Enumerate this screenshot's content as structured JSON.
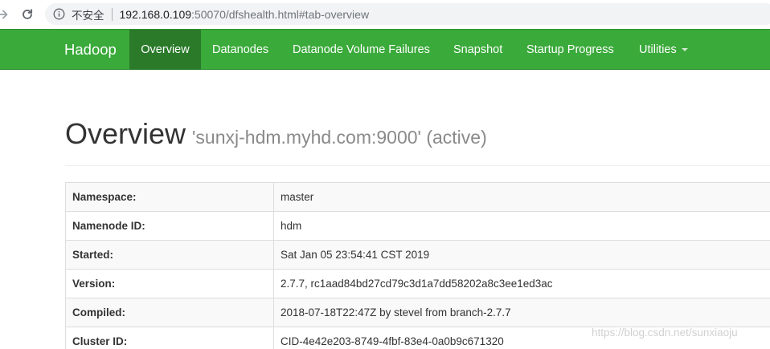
{
  "browser": {
    "insecure_label": "不安全",
    "url_host": "192.168.0.109",
    "url_rest": ":50070/dfshealth.html#tab-overview"
  },
  "navbar": {
    "brand": "Hadoop",
    "items": [
      {
        "label": "Overview",
        "active": true
      },
      {
        "label": "Datanodes"
      },
      {
        "label": "Datanode Volume Failures"
      },
      {
        "label": "Snapshot"
      },
      {
        "label": "Startup Progress"
      },
      {
        "label": "Utilities",
        "dropdown": true
      }
    ]
  },
  "header": {
    "title": "Overview",
    "subtitle": "'sunxj-hdm.myhd.com:9000' (active)"
  },
  "overview_table": {
    "rows": [
      {
        "key": "Namespace:",
        "value": "master"
      },
      {
        "key": "Namenode ID:",
        "value": "hdm"
      },
      {
        "key": "Started:",
        "value": "Sat Jan 05 23:54:41 CST 2019"
      },
      {
        "key": "Version:",
        "value": "2.7.7, rc1aad84bd27cd79c3d1a7dd58202a8c3ee1ed3ac"
      },
      {
        "key": "Compiled:",
        "value": "2018-07-18T22:47Z by stevel from branch-2.7.7"
      },
      {
        "key": "Cluster ID:",
        "value": "CID-4e42e203-8749-4fbf-83e4-0a0b9c671320"
      }
    ]
  },
  "watermark": "https://blog.csdn.net/sunxiaoju",
  "colors": {
    "navbar": "#3aaa3a",
    "navbar_active": "#2a7a2a"
  }
}
